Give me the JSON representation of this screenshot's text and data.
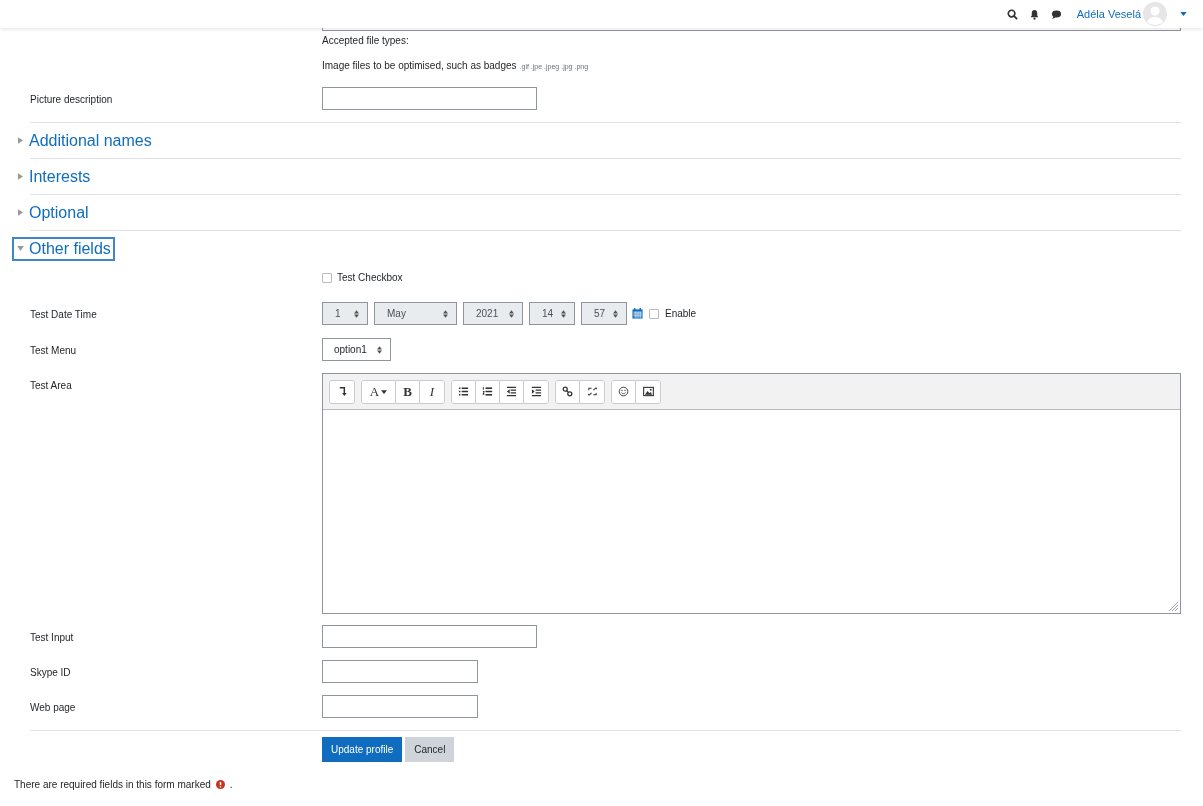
{
  "navbar": {
    "user_name": "Adéla Veselá"
  },
  "file_types": {
    "heading": "Accepted file types:",
    "description": "Image files to be optimised, such as badges",
    "extensions": ".gif .jpe .jpeg .jpg .png"
  },
  "picture_description": {
    "label": "Picture description"
  },
  "sections": [
    {
      "title": "Additional names",
      "expanded": false,
      "focused": false
    },
    {
      "title": "Interests",
      "expanded": false,
      "focused": false
    },
    {
      "title": "Optional",
      "expanded": false,
      "focused": false
    },
    {
      "title": "Other fields",
      "expanded": true,
      "focused": true
    }
  ],
  "test_checkbox": {
    "label": "Test Checkbox",
    "checked": false
  },
  "date_time": {
    "label": "Test Date Time",
    "selects": [
      {
        "value": "1",
        "kind": "narrow"
      },
      {
        "value": "May",
        "kind": "wide"
      },
      {
        "value": "2021",
        "kind": "medium"
      },
      {
        "value": "14",
        "kind": "narrow"
      },
      {
        "value": "57",
        "kind": "narrow"
      }
    ],
    "enable": {
      "label": "Enable",
      "checked": false
    }
  },
  "test_menu": {
    "label": "Test Menu",
    "value": "option1"
  },
  "test_area": {
    "label": "Test Area",
    "toolbar": [
      [
        {
          "kind": "collapse"
        }
      ],
      [
        {
          "kind": "font",
          "label": "A"
        },
        {
          "kind": "bold",
          "label": "B"
        },
        {
          "kind": "italic",
          "label": "I"
        }
      ],
      [
        {
          "kind": "bullets"
        },
        {
          "kind": "numbers"
        },
        {
          "kind": "outdent"
        },
        {
          "kind": "indent"
        }
      ],
      [
        {
          "kind": "link"
        },
        {
          "kind": "unlink"
        }
      ],
      [
        {
          "kind": "emoji"
        },
        {
          "kind": "image"
        }
      ]
    ]
  },
  "text_fields": [
    {
      "label": "Test Input",
      "kind": "wide"
    },
    {
      "label": "Skype ID",
      "kind": "narrow"
    },
    {
      "label": "Web page",
      "kind": "narrow"
    }
  ],
  "buttons": [
    {
      "label": "Update profile",
      "kind": "primary"
    },
    {
      "label": "Cancel",
      "kind": "secondary"
    }
  ],
  "required_note": {
    "text": "There are required fields in this form marked",
    "end": "."
  }
}
